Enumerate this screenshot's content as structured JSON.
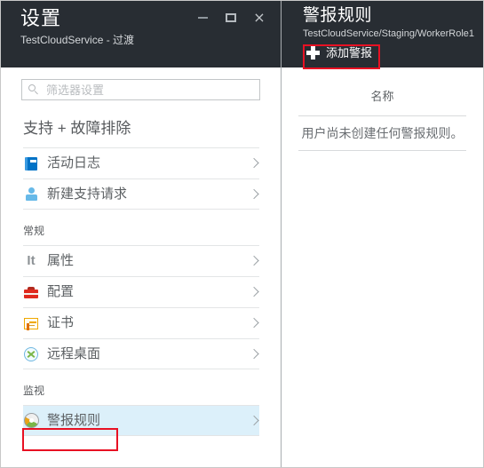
{
  "window": {
    "controls": [
      {
        "name": "minimize",
        "glyph": "minimize-icon"
      },
      {
        "name": "maximize",
        "glyph": "maximize-icon"
      },
      {
        "name": "close",
        "glyph": "×"
      }
    ]
  },
  "settings_blade": {
    "title": "设置",
    "subtitle": "TestCloudService - 过渡",
    "search": {
      "placeholder": "筛选器设置",
      "value": "",
      "icon": "search-icon"
    },
    "sections": [
      {
        "heading": "支持 + 故障排除",
        "heading_size": "big",
        "items": [
          {
            "label": "活动日志",
            "icon": "activity-log-icon",
            "selected": false
          },
          {
            "label": "新建支持请求",
            "icon": "support-request-icon",
            "selected": false
          }
        ]
      },
      {
        "heading": "常规",
        "heading_size": "small",
        "items": [
          {
            "label": "属性",
            "icon": "properties-it-icon",
            "selected": false
          },
          {
            "label": "配置",
            "icon": "configuration-toolbox-icon",
            "selected": false
          },
          {
            "label": "证书",
            "icon": "certificate-icon",
            "selected": false
          },
          {
            "label": "远程桌面",
            "icon": "remote-desktop-icon",
            "selected": false
          }
        ]
      },
      {
        "heading": "监视",
        "heading_size": "small",
        "items": [
          {
            "label": "警报规则",
            "icon": "alert-rules-icon",
            "selected": true
          }
        ]
      }
    ]
  },
  "alert_rules_blade": {
    "title": "警报规则",
    "subtitle": "TestCloudService/Staging/WorkerRole1",
    "add_button": {
      "label": "添加警报",
      "icon": "plus-icon"
    },
    "table": {
      "columns": [
        "名称"
      ],
      "empty_message": "用户尚未创建任何警报规则。"
    }
  },
  "annotations": {
    "highlight_color": "#e81123",
    "boxes": [
      "add-alert-button",
      "alert-rules-sidebar-item"
    ]
  },
  "colors": {
    "header_bg": "#282d33",
    "selected_row_bg": "#dcf0fa",
    "body_bg": "#ffffff",
    "accent_blue": "#0072c6"
  }
}
